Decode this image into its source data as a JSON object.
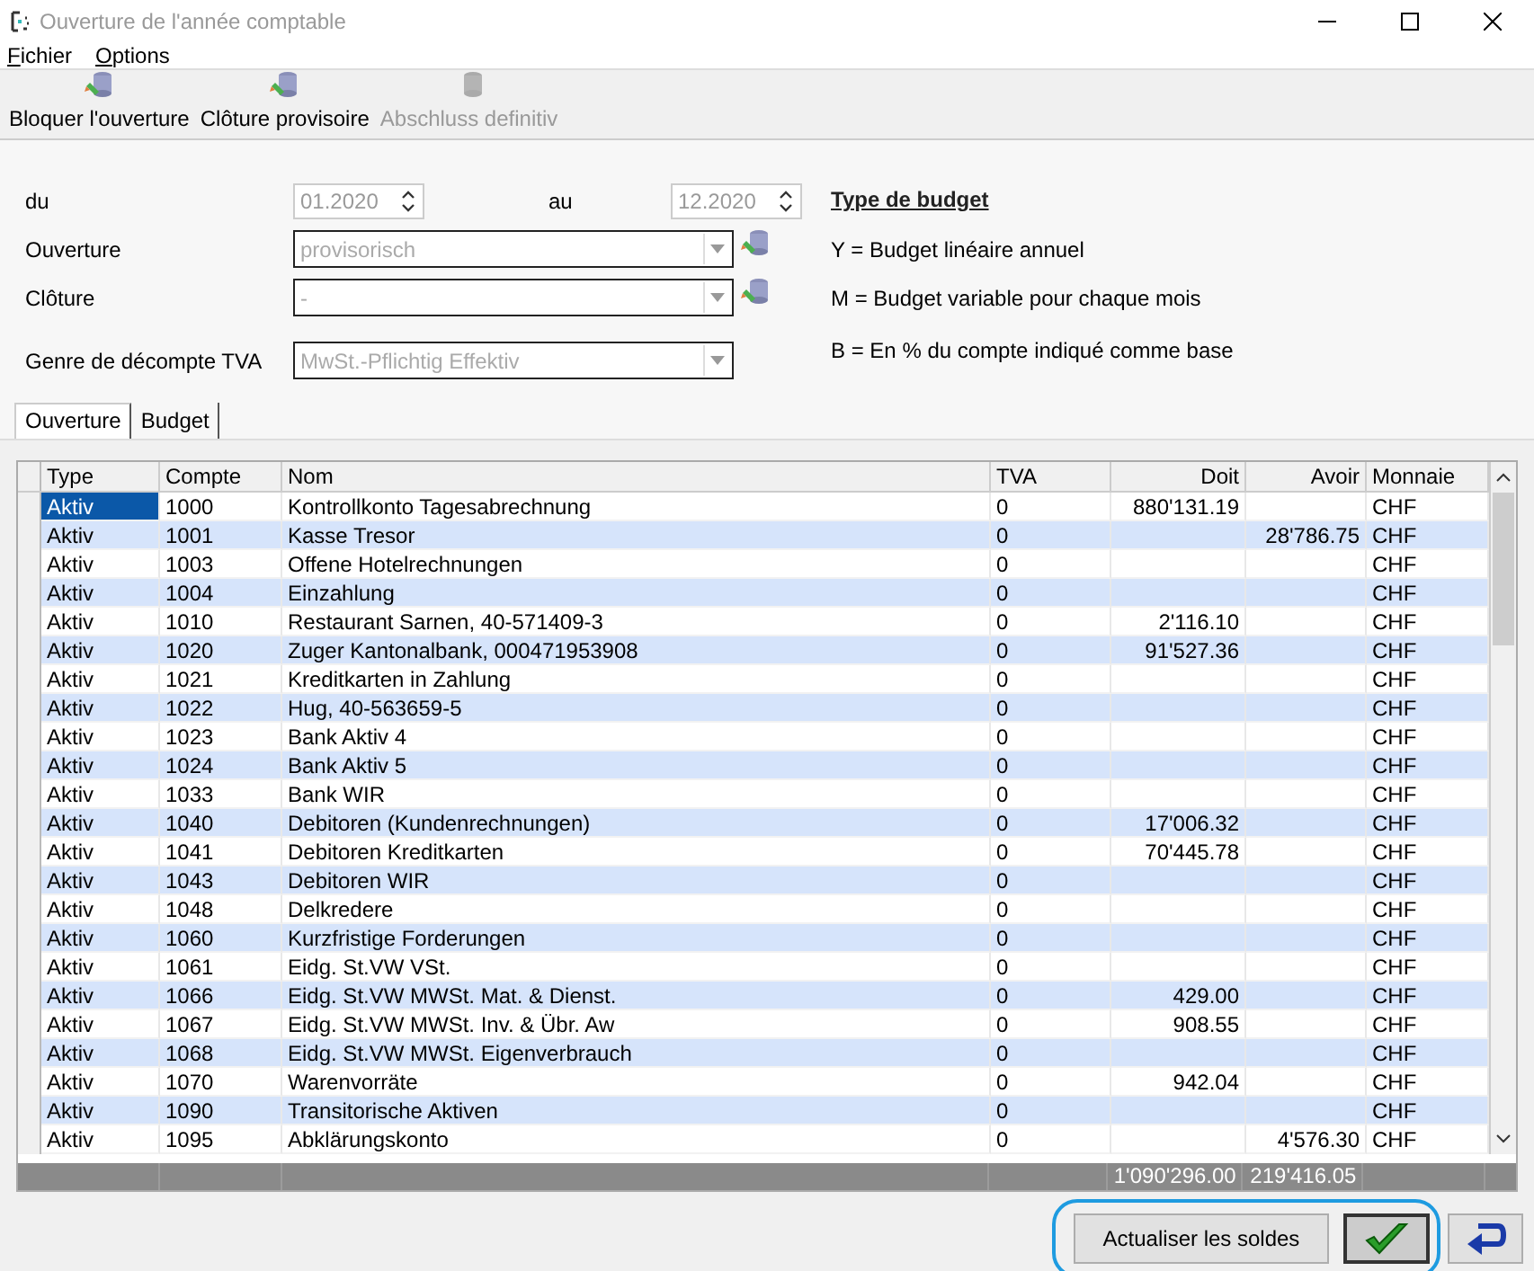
{
  "window": {
    "title": "Ouverture de l'année comptable"
  },
  "menu": [
    {
      "label": "Fichier"
    },
    {
      "label": "Options"
    }
  ],
  "toolbar": [
    {
      "label": "Bloquer l'ouverture",
      "disabled": false
    },
    {
      "label": "Clôture provisoire",
      "disabled": false
    },
    {
      "label": "Abschluss definitiv",
      "disabled": true
    }
  ],
  "period": {
    "from_label": "du",
    "from_value": "01.2020",
    "to_label": "au",
    "to_value": "12.2020"
  },
  "fields": [
    {
      "label": "Ouverture",
      "value": "provisorisch",
      "action": true
    },
    {
      "label": "Clôture",
      "value": "-",
      "action": true
    },
    {
      "label": "Genre de décompte TVA",
      "value": "MwSt.-Pflichtig Effektiv",
      "action": false
    }
  ],
  "budget_legend": {
    "title": "Type de budget",
    "lines": [
      "Y = Budget linéaire annuel",
      "M = Budget variable pour chaque mois",
      "B = En % du compte indiqué comme base"
    ]
  },
  "tabs": [
    {
      "label": "Ouverture",
      "selected": true
    },
    {
      "label": "Budget",
      "selected": false
    }
  ],
  "table": {
    "columns": [
      "Type",
      "Compte",
      "Nom",
      "TVA",
      "Doit",
      "Avoir",
      "Monnaie"
    ],
    "rows": [
      {
        "cells": [
          "Aktiv",
          "1000",
          "Kontrollkonto Tagesabrechnung",
          "0",
          "880'131.19",
          "",
          "CHF"
        ],
        "selected": true
      },
      {
        "cells": [
          "Aktiv",
          "1001",
          "Kasse Tresor",
          "0",
          "",
          "28'786.75",
          "CHF"
        ],
        "selected": false
      },
      {
        "cells": [
          "Aktiv",
          "1003",
          "Offene Hotelrechnungen",
          "0",
          "",
          "",
          "CHF"
        ],
        "selected": false
      },
      {
        "cells": [
          "Aktiv",
          "1004",
          "Einzahlung",
          "0",
          "",
          "",
          "CHF"
        ],
        "selected": false
      },
      {
        "cells": [
          "Aktiv",
          "1010",
          "Restaurant Sarnen, 40-571409-3",
          "0",
          "2'116.10",
          "",
          "CHF"
        ],
        "selected": false
      },
      {
        "cells": [
          "Aktiv",
          "1020",
          "Zuger Kantonalbank, 000471953908",
          "0",
          "91'527.36",
          "",
          "CHF"
        ],
        "selected": false
      },
      {
        "cells": [
          "Aktiv",
          "1021",
          "Kreditkarten in Zahlung",
          "0",
          "",
          "",
          "CHF"
        ],
        "selected": false
      },
      {
        "cells": [
          "Aktiv",
          "1022",
          "Hug, 40-563659-5",
          "0",
          "",
          "",
          "CHF"
        ],
        "selected": false
      },
      {
        "cells": [
          "Aktiv",
          "1023",
          "Bank Aktiv 4",
          "0",
          "",
          "",
          "CHF"
        ],
        "selected": false
      },
      {
        "cells": [
          "Aktiv",
          "1024",
          "Bank Aktiv 5",
          "0",
          "",
          "",
          "CHF"
        ],
        "selected": false
      },
      {
        "cells": [
          "Aktiv",
          "1033",
          "Bank WIR",
          "0",
          "",
          "",
          "CHF"
        ],
        "selected": false
      },
      {
        "cells": [
          "Aktiv",
          "1040",
          "Debitoren (Kundenrechnungen)",
          "0",
          "17'006.32",
          "",
          "CHF"
        ],
        "selected": false
      },
      {
        "cells": [
          "Aktiv",
          "1041",
          "Debitoren Kreditkarten",
          "0",
          "70'445.78",
          "",
          "CHF"
        ],
        "selected": false
      },
      {
        "cells": [
          "Aktiv",
          "1043",
          "Debitoren WIR",
          "0",
          "",
          "",
          "CHF"
        ],
        "selected": false
      },
      {
        "cells": [
          "Aktiv",
          "1048",
          "Delkredere",
          "0",
          "",
          "",
          "CHF"
        ],
        "selected": false
      },
      {
        "cells": [
          "Aktiv",
          "1060",
          "Kurzfristige Forderungen",
          "0",
          "",
          "",
          "CHF"
        ],
        "selected": false
      },
      {
        "cells": [
          "Aktiv",
          "1061",
          "Eidg. St.VW VSt.",
          "0",
          "",
          "",
          "CHF"
        ],
        "selected": false
      },
      {
        "cells": [
          "Aktiv",
          "1066",
          "Eidg. St.VW MWSt. Mat. & Dienst.",
          "0",
          "429.00",
          "",
          "CHF"
        ],
        "selected": false
      },
      {
        "cells": [
          "Aktiv",
          "1067",
          "Eidg. St.VW MWSt. Inv. & Übr. Aw",
          "0",
          "908.55",
          "",
          "CHF"
        ],
        "selected": false
      },
      {
        "cells": [
          "Aktiv",
          "1068",
          "Eidg. St.VW MWSt. Eigenverbrauch",
          "0",
          "",
          "",
          "CHF"
        ],
        "selected": false
      },
      {
        "cells": [
          "Aktiv",
          "1070",
          "Warenvorräte",
          "0",
          "942.04",
          "",
          "CHF"
        ],
        "selected": false
      },
      {
        "cells": [
          "Aktiv",
          "1090",
          "Transitorische Aktiven",
          "0",
          "",
          "",
          "CHF"
        ],
        "selected": false
      },
      {
        "cells": [
          "Aktiv",
          "1095",
          "Abklärungskonto",
          "0",
          "",
          "4'576.30",
          "CHF"
        ],
        "selected": false
      }
    ],
    "totals": {
      "debit": "1'090'296.00",
      "credit": "219'416.05"
    }
  },
  "buttons": [
    {
      "kind": "text",
      "label": "Actualiser les soldes"
    },
    {
      "kind": "ok"
    },
    {
      "kind": "back"
    }
  ]
}
